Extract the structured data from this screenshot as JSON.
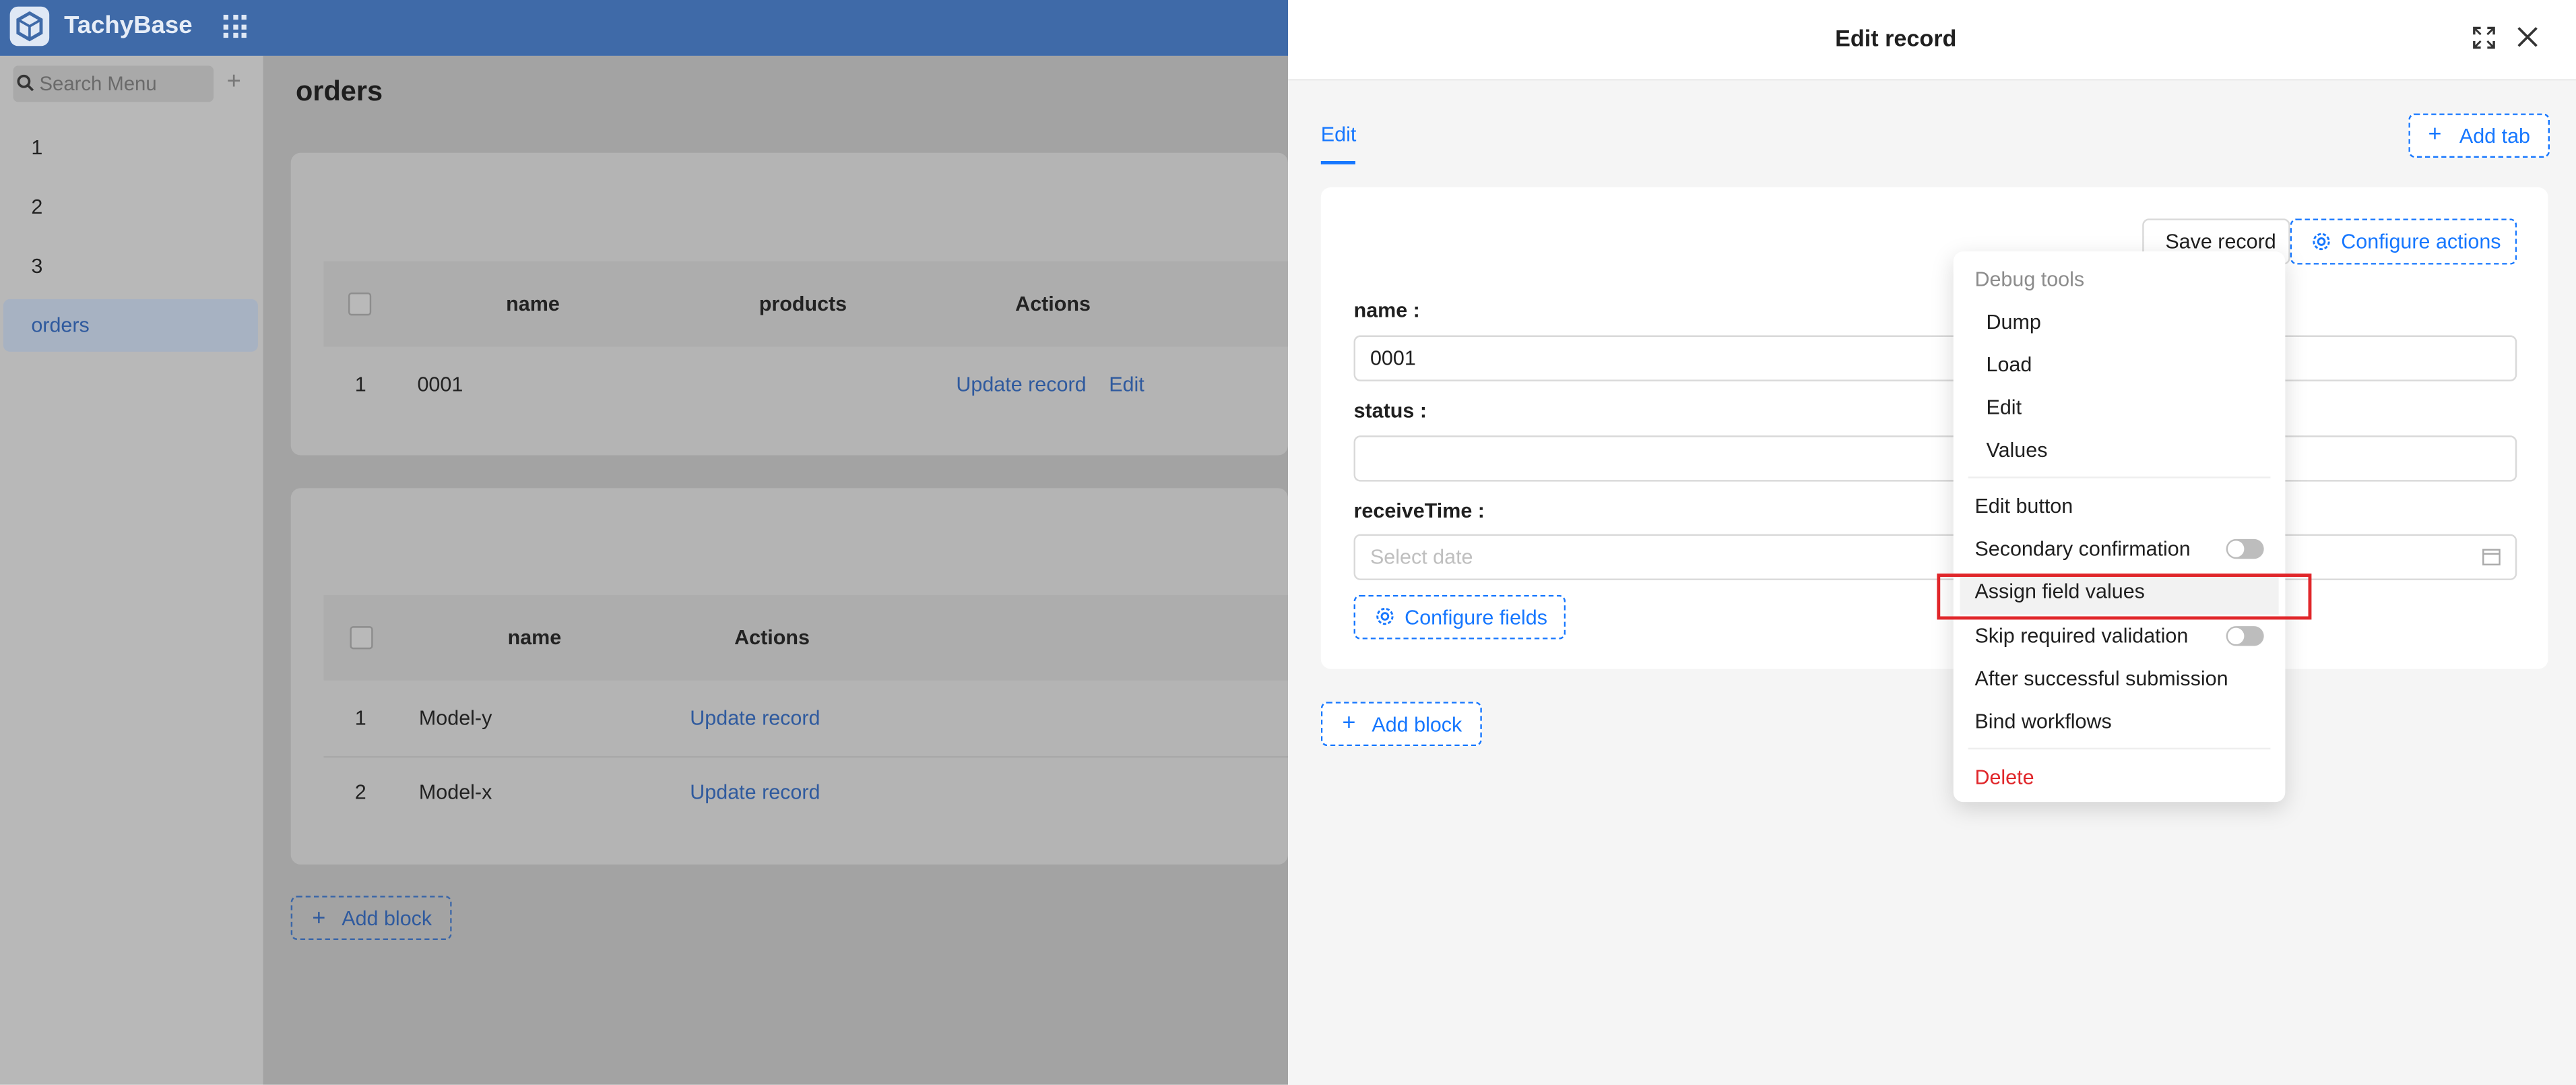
{
  "app": {
    "name": "TachyBase"
  },
  "sidebar": {
    "search_placeholder": "Search Menu",
    "add_symbol": "+",
    "items": [
      {
        "label": "1"
      },
      {
        "label": "2"
      },
      {
        "label": "3"
      },
      {
        "label": "orders",
        "active": true
      }
    ]
  },
  "main": {
    "title": "orders",
    "table1": {
      "headers": [
        "name",
        "products",
        "Actions"
      ],
      "rows": [
        {
          "index": "1",
          "name": "0001",
          "actions": [
            "Update record",
            "Edit"
          ]
        }
      ]
    },
    "table2": {
      "headers": [
        "name",
        "Actions"
      ],
      "rows": [
        {
          "index": "1",
          "name": "Model-y",
          "action": "Update record"
        },
        {
          "index": "2",
          "name": "Model-x",
          "action": "Update record"
        }
      ]
    },
    "add_block": "Add block"
  },
  "drawer": {
    "title": "Edit record",
    "tab": "Edit",
    "add_tab": "Add tab",
    "save_record": "Save record",
    "configure_actions": "Configure actions",
    "fields": [
      {
        "label": "name",
        "value": "0001"
      },
      {
        "label": "status",
        "value": ""
      },
      {
        "label": "receiveTime",
        "placeholder": "Select date"
      }
    ],
    "configure_fields": "Configure fields",
    "add_block": "Add block"
  },
  "menu": {
    "debug_group": "Debug tools",
    "debug_items": [
      "Dump",
      "Load",
      "Edit",
      "Values"
    ],
    "edit_button": "Edit button",
    "secondary_confirmation": "Secondary confirmation",
    "assign_field_values": "Assign field values",
    "skip_required_validation": "Skip required validation",
    "after_successful_submission": "After successful submission",
    "bind_workflows": "Bind workflows",
    "delete": "Delete"
  },
  "colors": {
    "primary": "#1677ff",
    "danger": "#e0262a",
    "header": "#3f6aa8"
  }
}
